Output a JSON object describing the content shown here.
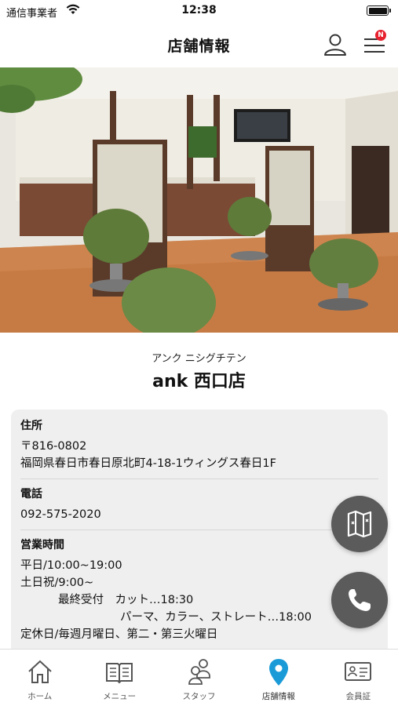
{
  "status_bar": {
    "carrier": "通信事業者",
    "time": "12:38",
    "battery_level": 1.0
  },
  "header": {
    "title": "店舗情報",
    "badge": "N"
  },
  "shop": {
    "kana": "アンク ニシグチテン",
    "name": "ank 西口店"
  },
  "info": {
    "address": {
      "label": "住所",
      "postal": "〒816-0802",
      "line": "福岡県春日市春日原北町4-18-1ウィングス春日1F"
    },
    "phone": {
      "label": "電話",
      "number": "092-575-2020"
    },
    "hours": {
      "label": "営業時間",
      "weekday": "平日/10:00~19:00",
      "weekend": "土日祝/9:00~",
      "last_cut": "最終受付　カット…18:30",
      "last_perm": "パーマ、カラー、ストレート…18:00",
      "holiday": "定休日/毎週月曜日、第二・第三火曜日"
    }
  },
  "tabs": [
    {
      "label": "ホーム",
      "icon": "home-icon"
    },
    {
      "label": "メニュー",
      "icon": "book-icon"
    },
    {
      "label": "スタッフ",
      "icon": "staff-icon"
    },
    {
      "label": "店舗情報",
      "icon": "location-pin-icon",
      "active": true
    },
    {
      "label": "会員証",
      "icon": "member-card-icon"
    }
  ],
  "colors": {
    "accent": "#1a9bd8",
    "fab": "#5b5b5b",
    "badge": "#e8212e",
    "card": "#efefef"
  }
}
